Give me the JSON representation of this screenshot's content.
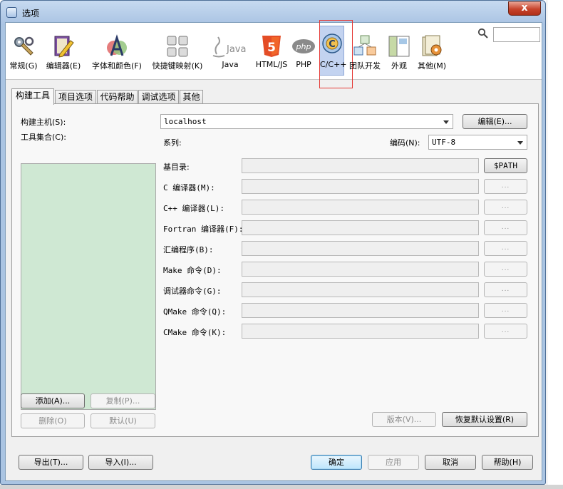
{
  "window": {
    "title": "选项",
    "close_label": "x"
  },
  "search": {
    "placeholder": "",
    "value": ""
  },
  "categories": [
    {
      "label": "常规(G)",
      "icon": "wrench-gear-icon"
    },
    {
      "label": "编辑器(E)",
      "icon": "pencil-book-icon"
    },
    {
      "label": "字体和颜色(F)",
      "icon": "font-a-icon"
    },
    {
      "label": "快捷键映射(K)",
      "icon": "keyboard-icon"
    },
    {
      "label": "Java",
      "icon": "java-icon"
    },
    {
      "label": "HTML/JS",
      "icon": "html5-icon"
    },
    {
      "label": "PHP",
      "icon": "php-icon"
    },
    {
      "label": "C/C++",
      "icon": "cpp-icon",
      "selected": true
    },
    {
      "label": "团队开发",
      "icon": "team-cubes-icon"
    },
    {
      "label": "外观",
      "icon": "appearance-window-icon"
    },
    {
      "label": "其他(M)",
      "icon": "misc-gear-icon"
    }
  ],
  "icon_text": {
    "java": "Java",
    "php": "php",
    "html5": "5",
    "cpp": "C"
  },
  "tabs": [
    {
      "label": "构建工具",
      "active": true
    },
    {
      "label": "项目选项"
    },
    {
      "label": "代码帮助"
    },
    {
      "label": "调试选项"
    },
    {
      "label": "其他"
    }
  ],
  "build": {
    "host_label": "构建主机(S):",
    "host_value": "localhost",
    "edit_button": "编辑(E)...",
    "toolset_label": "工具集合(C):",
    "family_label": "系列:",
    "encoding_label": "编码(N):",
    "encoding_value": "UTF-8",
    "base_dir_label": "基目录:",
    "path_button": "$PATH",
    "dots_label": "...",
    "tools": [
      {
        "label": "C 编译器(M):"
      },
      {
        "label": "C++ 编译器(L):"
      },
      {
        "label": "Fortran 编译器(F):"
      },
      {
        "label": "汇编程序(B):"
      },
      {
        "label": "Make 命令(D):"
      },
      {
        "label": "调试器命令(G):"
      },
      {
        "label": "QMake 命令(Q):"
      },
      {
        "label": "CMake 命令(K):"
      }
    ],
    "add_button": "添加(A)...",
    "copy_button": "复制(P)...",
    "delete_button": "删除(O)",
    "default_button": "默认(U)",
    "versions_button": "版本(V)...",
    "restore_button": "恢复默认设置(R)"
  },
  "footer": {
    "export_button": "导出(T)...",
    "import_button": "导入(I)...",
    "ok_button": "确定",
    "apply_button": "应用",
    "cancel_button": "取消",
    "help_button": "帮助(H)"
  },
  "colors": {
    "toolset_list_bg": "#cfe8d3",
    "selected_category_bg": "#c3d3f0",
    "close_button": "#c7432b",
    "selection_outline": "#e53935"
  }
}
